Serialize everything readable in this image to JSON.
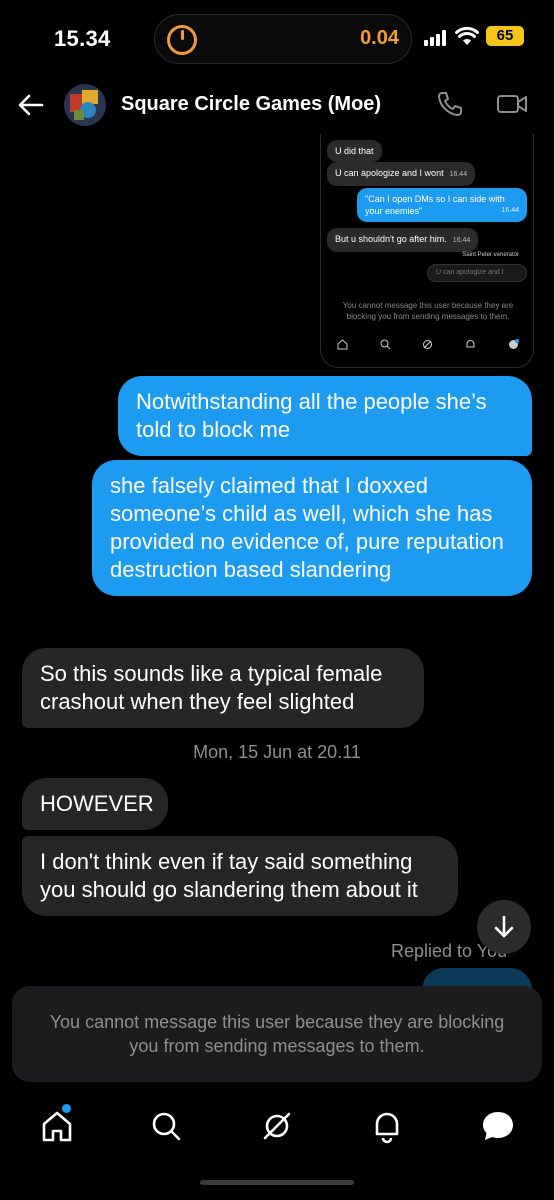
{
  "status_bar": {
    "time": "15.34",
    "counter": "0.04",
    "battery": "65"
  },
  "header": {
    "contact_name": "Square Circle Games (Moe)"
  },
  "embedded_screenshot": {
    "messages": [
      {
        "text": "U did that",
        "time": ""
      },
      {
        "text": "U can apologize and I wont",
        "time": "16.44"
      },
      {
        "text": "\"Can I open DMs so I can side with your enemies\"",
        "time": "16.44"
      },
      {
        "text": "But u shouldn't go after him.",
        "time": "16.44"
      }
    ],
    "reply_meta": "Saint Peter venerator",
    "input_preview": "U can apologize and I",
    "notice": "You cannot message this user because they are blocking you from sending messages to them."
  },
  "messages": [
    {
      "direction": "sent",
      "text": "Notwithstanding all the people she’s told to block me"
    },
    {
      "direction": "sent",
      "text": "she falsely claimed that I doxxed someone’s child as well, which she has provided no evidence of, pure reputation destruction based slandering"
    },
    {
      "direction": "received",
      "text": "So this sounds like a typical female crashout when they feel slighted"
    },
    {
      "direction": "received",
      "text": "HOWEVER"
    },
    {
      "direction": "received",
      "text": "I don't think even if tay said something you should go slandering them about it"
    }
  ],
  "date_separator": "Mon, 15 Jun at 20.11",
  "replied_label": "Replied to You",
  "block_notice": "You cannot message this user because they are blocking you from sending messages to them.",
  "bottom_nav": {
    "items": [
      "home-icon",
      "search-icon",
      "grok-icon",
      "notifications-icon",
      "messages-icon"
    ]
  },
  "colors": {
    "accent": "#1d9bf0",
    "received_bubble": "#262626",
    "background": "#000000"
  }
}
